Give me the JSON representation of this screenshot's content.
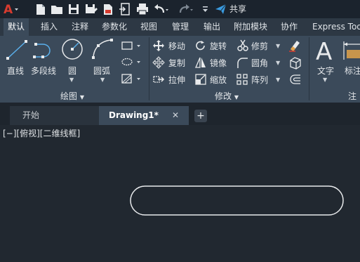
{
  "quick_access": {
    "share_label": "共享",
    "icons": [
      "app-menu-icon",
      "new-file-icon",
      "open-folder-icon",
      "save-icon",
      "save-as-icon",
      "export-pdf-icon",
      "import-icon",
      "export-icon",
      "print-icon",
      "undo-icon",
      "redo-icon",
      "customize-icon",
      "share-icon"
    ]
  },
  "ribbon_tabs": [
    "默认",
    "插入",
    "注释",
    "参数化",
    "视图",
    "管理",
    "输出",
    "附加模块",
    "协作",
    "Express Tools"
  ],
  "active_tab": "默认",
  "draw_panel": {
    "line": "直线",
    "polyline": "多段线",
    "circle": "圆",
    "arc": "圆弧",
    "title": "绘图"
  },
  "modify_panel": {
    "move": "移动",
    "rotate": "旋转",
    "trim": "修剪",
    "copy": "复制",
    "mirror": "镜像",
    "fillet": "圆角",
    "stretch": "拉伸",
    "scale": "缩放",
    "array": "阵列",
    "title": "修改"
  },
  "text_panel": {
    "text": "文字",
    "dimension": "标注",
    "title": "注"
  },
  "doc_tabs": {
    "start": "开始",
    "drawing": "Drawing1*",
    "close_glyph": "✕",
    "add_glyph": "+"
  },
  "viewport_label": "[−][俯视][二维线框]",
  "colors": {
    "accent_red": "#d63b2f",
    "share_blue": "#3a9be0",
    "ribbon_bg": "#3b4a5a",
    "canvas_bg": "#212830"
  }
}
